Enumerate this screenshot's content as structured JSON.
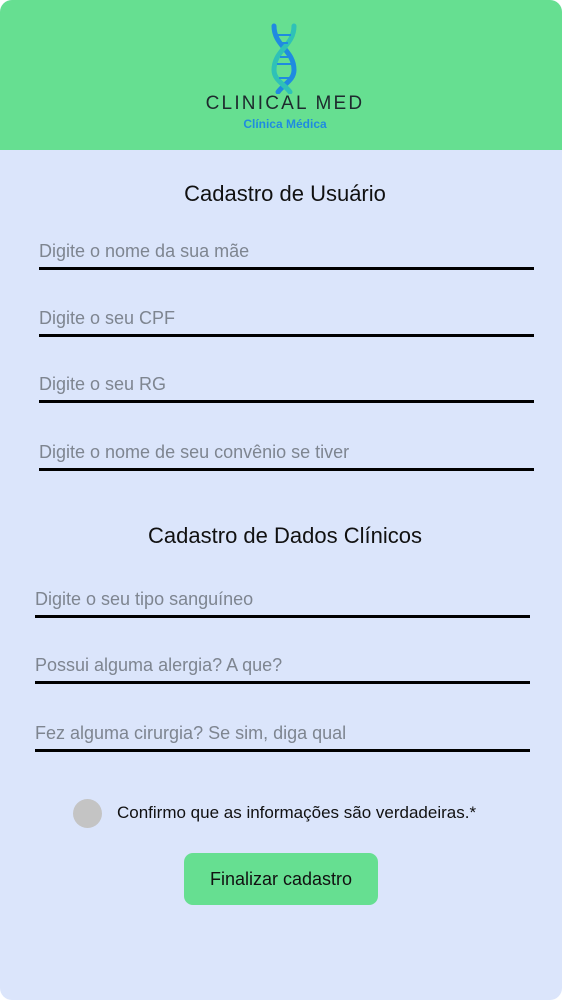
{
  "brand": {
    "name": "CLINICAL MED",
    "subtitle": "Clínica Médica",
    "logo_icon": "dna-icon",
    "colors": {
      "header_bg": "#66df91",
      "dna_primary": "#1f8be0",
      "dna_secondary": "#2fc1b7"
    }
  },
  "user_section": {
    "title": "Cadastro de Usuário",
    "fields": [
      {
        "placeholder": "Digite o nome da sua mãe",
        "value": ""
      },
      {
        "placeholder": "Digite o seu CPF",
        "value": ""
      },
      {
        "placeholder": "Digite o seu RG",
        "value": ""
      },
      {
        "placeholder": "Digite o nome de seu convênio se tiver",
        "value": ""
      }
    ]
  },
  "clinical_section": {
    "title": "Cadastro de Dados Clínicos",
    "fields": [
      {
        "placeholder": "Digite o seu tipo sanguíneo",
        "value": ""
      },
      {
        "placeholder": "Possui alguma alergia? A que?",
        "value": ""
      },
      {
        "placeholder": "Fez alguma cirurgia? Se sim, diga qual",
        "value": ""
      }
    ]
  },
  "confirm": {
    "label": "Confirmo que as informações são verdadeiras.*",
    "checked": false
  },
  "submit": {
    "label": "Finalizar cadastro"
  },
  "theme": {
    "background": "#dbe5fb",
    "accent": "#66df91",
    "radio_unchecked": "#c4c4c4"
  }
}
